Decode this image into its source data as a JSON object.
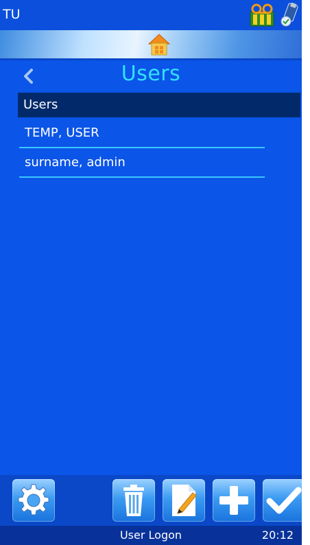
{
  "status": {
    "device_id": "TU",
    "icons": [
      "ribbon-cassette-icon",
      "usb-drive-icon"
    ]
  },
  "nav": {
    "home_icon": "home-icon",
    "back_icon": "chevron-left-icon",
    "title": "Users"
  },
  "list": {
    "header": "Users",
    "items": [
      {
        "label": "TEMP, USER"
      },
      {
        "label": "surname, admin"
      }
    ]
  },
  "toolbar": {
    "buttons": [
      {
        "name": "settings",
        "icon": "gear-icon"
      },
      {
        "name": "delete",
        "icon": "trash-icon"
      },
      {
        "name": "edit",
        "icon": "edit-document-icon"
      },
      {
        "name": "add",
        "icon": "plus-icon"
      },
      {
        "name": "confirm",
        "icon": "checkmark-icon"
      }
    ]
  },
  "footer": {
    "title": "User Logon",
    "clock": "20:12"
  },
  "colors": {
    "background": "#0b55e8",
    "title": "#33e0ff",
    "selected_row": "#022a6b",
    "divider": "#39c8ff",
    "footer": "#08329a"
  }
}
